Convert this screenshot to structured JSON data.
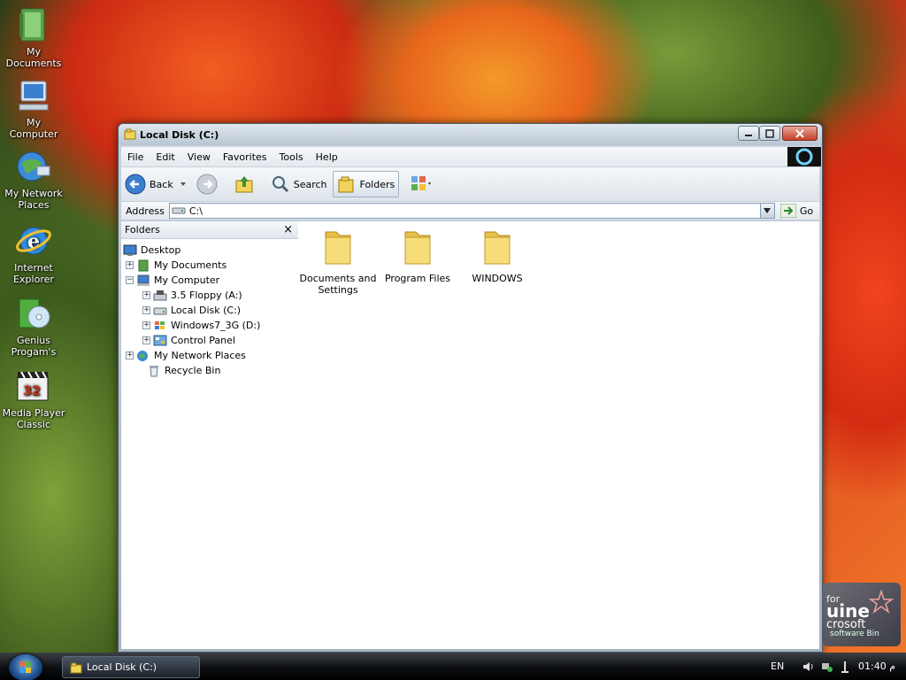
{
  "desktop": {
    "icons": [
      {
        "label": "My Documents"
      },
      {
        "label": "My Computer"
      },
      {
        "label_1": "My Network",
        "label_2": "Places"
      },
      {
        "label_1": "Internet",
        "label_2": "Explorer"
      },
      {
        "label_1": "Genius",
        "label_2": "Progam's"
      },
      {
        "label_1": "Media Player",
        "label_2": "Classic"
      }
    ]
  },
  "window": {
    "title": "Local Disk (C:)",
    "menu": [
      "File",
      "Edit",
      "View",
      "Favorites",
      "Tools",
      "Help"
    ],
    "toolbar": {
      "back": "Back",
      "search": "Search",
      "folders": "Folders"
    },
    "address": {
      "label": "Address",
      "value": "C:\\",
      "go": "Go"
    },
    "folders_pane": {
      "title": "Folders",
      "close": "×",
      "tree": [
        {
          "label": "Desktop"
        },
        {
          "label": "My Documents",
          "exp": "+"
        },
        {
          "label": "My Computer",
          "exp": "−"
        },
        {
          "label": "3.5 Floppy (A:)",
          "exp": "+"
        },
        {
          "label": "Local Disk (C:)",
          "exp": "+"
        },
        {
          "label": "Windows7_3G (D:)",
          "exp": "+"
        },
        {
          "label": "Control Panel",
          "exp": "+"
        },
        {
          "label": "My Network Places",
          "exp": "+"
        },
        {
          "label": "Recycle Bin"
        }
      ]
    },
    "files": [
      {
        "line1": "Documents and",
        "line2": "Settings"
      },
      {
        "line1": "Program Files",
        "line2": ""
      },
      {
        "line1": "WINDOWS",
        "line2": ""
      }
    ]
  },
  "genuine_badge": {
    "l1": "for",
    "l2": "uine",
    "l3": "crosoft",
    "l4": "software Bin"
  },
  "taskbar": {
    "task_title": "Local Disk (C:)",
    "lang": "EN",
    "clock": "01:40 م"
  },
  "colors": {
    "window_frame": "#b9c6d2",
    "taskbar": "#0d0f12",
    "folder": "#f3d35a"
  }
}
